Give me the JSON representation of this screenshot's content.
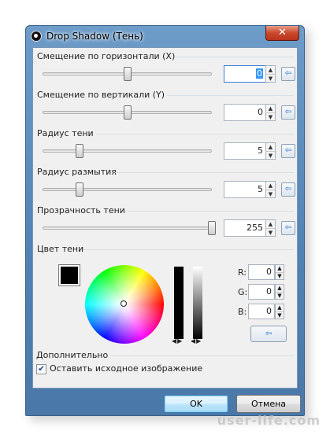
{
  "window": {
    "title": "Drop Shadow (Тень)",
    "close_glyph": "✕"
  },
  "sliders": [
    {
      "label": "Смещение по горизонтали (X)",
      "value": "0",
      "position": 0.5
    },
    {
      "label": "Смещение по вертикали (Y)",
      "value": "0",
      "position": 0.5
    },
    {
      "label": "Радиус тени",
      "value": "5",
      "position": 0.22
    },
    {
      "label": "Радиус размытия",
      "value": "5",
      "position": 0.22
    },
    {
      "label": "Прозрачность тени",
      "value": "255",
      "position": 1.0
    }
  ],
  "color_section": {
    "label": "Цвет тени",
    "swatch_color": "#000000",
    "rgb": [
      {
        "label": "R:",
        "value": "0"
      },
      {
        "label": "G:",
        "value": "0"
      },
      {
        "label": "B:",
        "value": "0"
      }
    ]
  },
  "extra": {
    "label": "Дополнительно",
    "checkbox_label": "Оставить исходное изображение",
    "checked": true
  },
  "buttons": {
    "ok": "OK",
    "cancel": "Отмена"
  },
  "icons": {
    "spin_up": "▲",
    "spin_down": "▼",
    "reset": "⇦",
    "check": "✔"
  },
  "watermark": "user-life.com"
}
